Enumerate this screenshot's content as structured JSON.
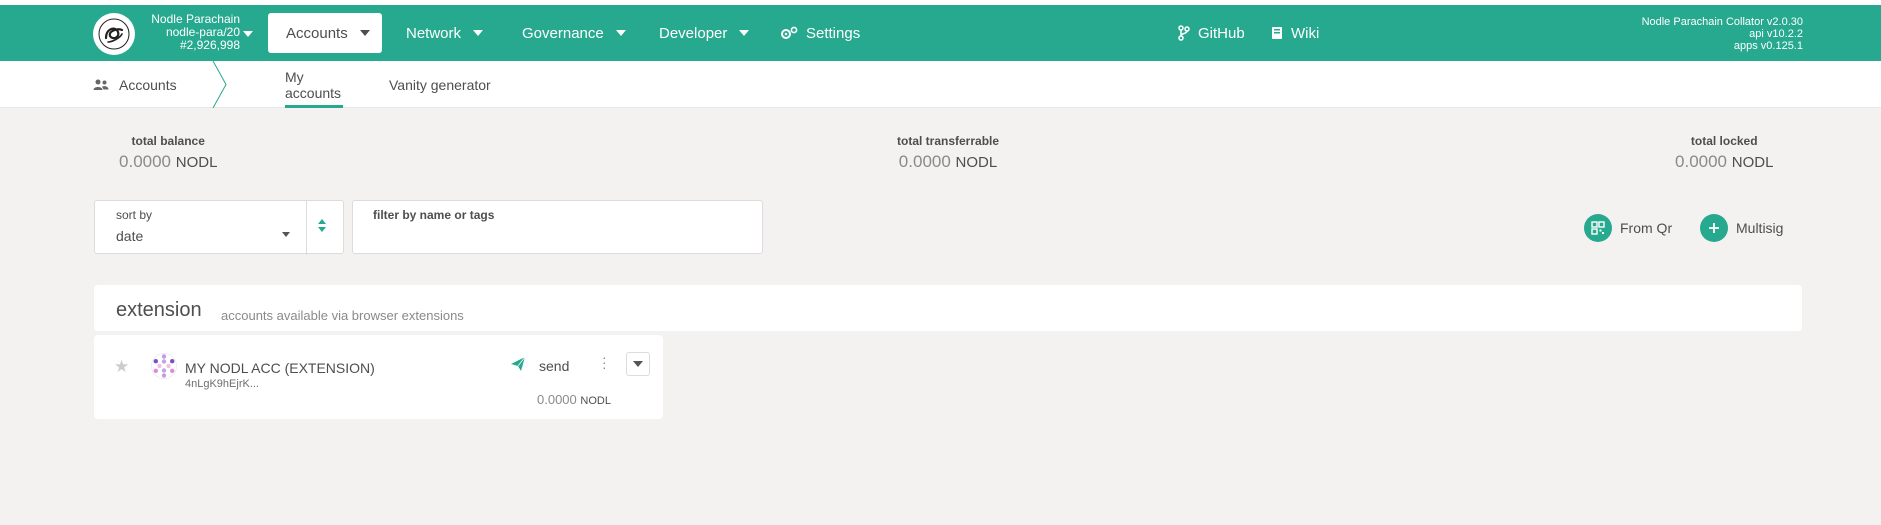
{
  "chain": {
    "name": "Nodle Parachain",
    "endpoint": "nodle-para/20",
    "block": "#2,926,998"
  },
  "nav": {
    "accounts": "Accounts",
    "network": "Network",
    "governance": "Governance",
    "developer": "Developer",
    "settings": "Settings",
    "github": "GitHub",
    "wiki": "Wiki"
  },
  "node": {
    "version": "Nodle Parachain Collator v2.0.30",
    "api": "api v10.2.2",
    "apps": "apps v0.125.1"
  },
  "subnav": {
    "section": "Accounts",
    "tabs": [
      "My accounts",
      "Vanity generator"
    ]
  },
  "summary": {
    "total_balance": {
      "label": "total balance",
      "int": "0.",
      "dec": "0000",
      "unit": "NODL"
    },
    "total_transferrable": {
      "label": "total transferrable",
      "int": "0.",
      "dec": "0000",
      "unit": "NODL"
    },
    "total_locked": {
      "label": "total locked",
      "int": "0.",
      "dec": "0000",
      "unit": "NODL"
    }
  },
  "sort": {
    "label": "sort by",
    "value": "date"
  },
  "filter": {
    "label": "filter by name or tags",
    "value": ""
  },
  "actions": {
    "from_qr": "From Qr",
    "multisig": "Multisig"
  },
  "extension": {
    "title": "extension",
    "description": "accounts available via browser extensions"
  },
  "account": {
    "name": "MY NODL ACC (EXTENSION)",
    "address": "4nLgK9hEjrK...",
    "send_label": "send",
    "balance_int": "0.",
    "balance_dec": "0000",
    "balance_unit": "NODL"
  },
  "colors": {
    "accent": "#26a98f",
    "background": "#f4f2f0"
  }
}
